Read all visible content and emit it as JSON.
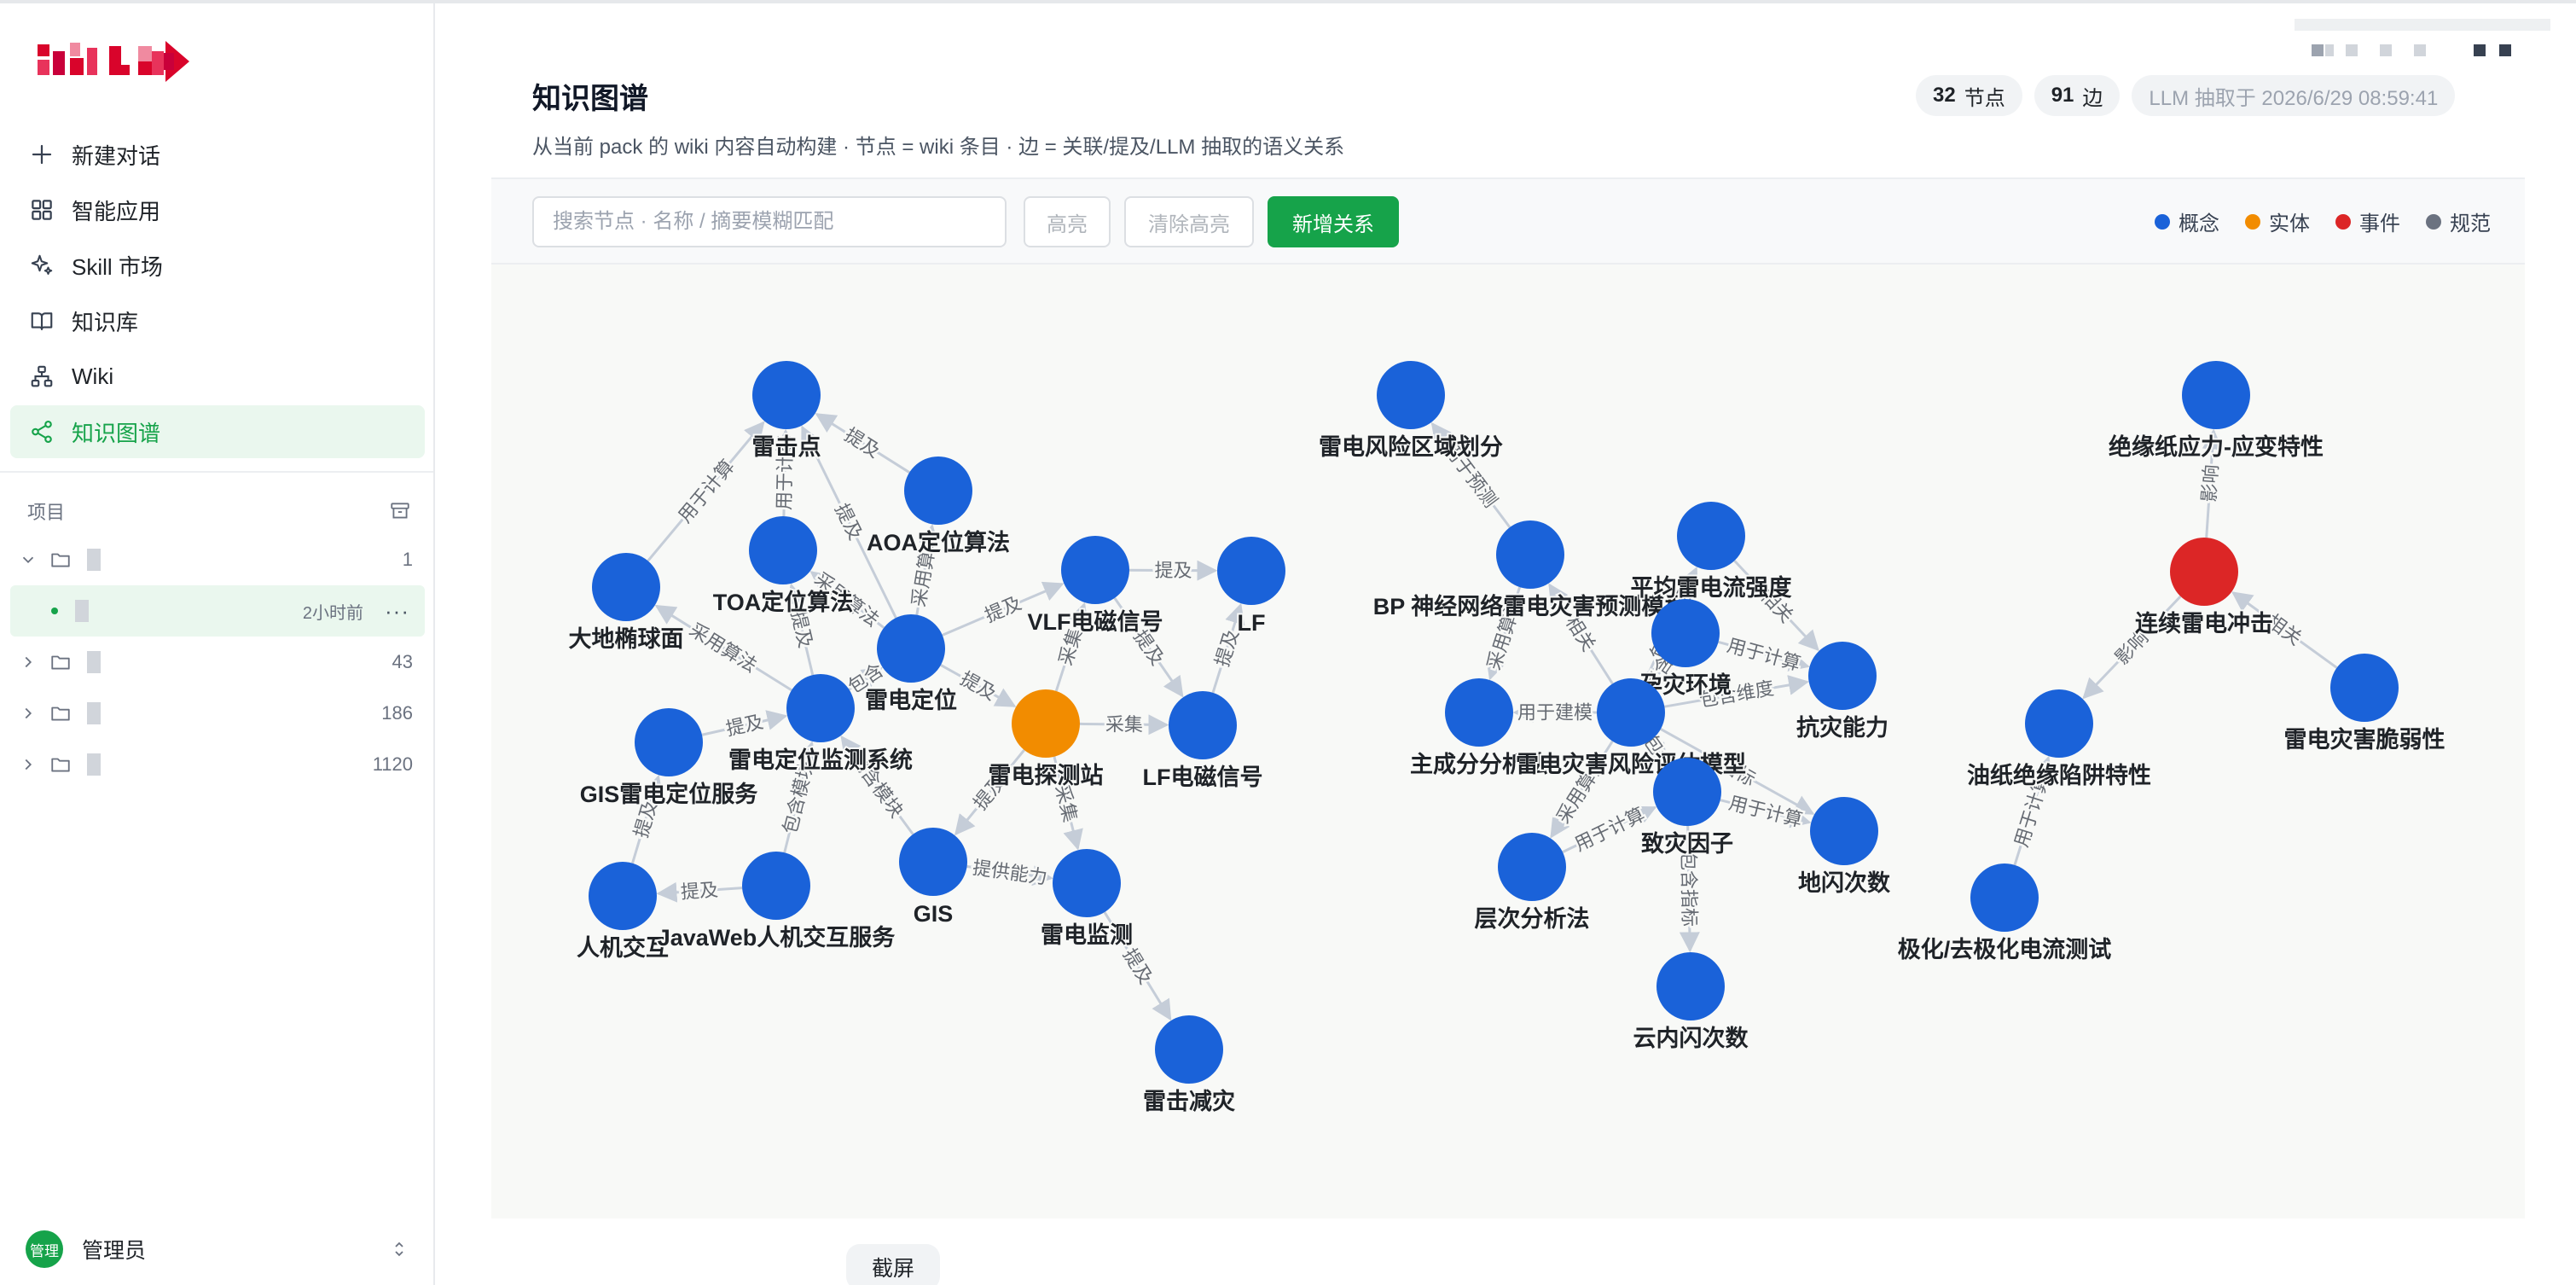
{
  "sidebar": {
    "nav": [
      {
        "label": "新建对话",
        "icon": "plus-icon"
      },
      {
        "label": "智能应用",
        "icon": "grid-icon"
      },
      {
        "label": "Skill 市场",
        "icon": "sparkle-icon"
      },
      {
        "label": "知识库",
        "icon": "book-icon"
      },
      {
        "label": "Wiki",
        "icon": "sitemap-icon"
      },
      {
        "label": "知识图谱",
        "icon": "share-nodes-icon"
      }
    ],
    "projects_header": "项目",
    "projects": [
      {
        "name": "",
        "count": "1"
      },
      {
        "name": "",
        "count": "43"
      },
      {
        "name": "",
        "count": "186"
      },
      {
        "name": "",
        "count": "1120"
      }
    ],
    "sub_item": {
      "name": "",
      "time": "2小时前",
      "more": "···"
    },
    "user": {
      "avatar_text": "管理",
      "name": "管理员"
    }
  },
  "header": {
    "title": "知识图谱",
    "subtitle": "从当前 pack 的 wiki 内容自动构建 · 节点 = wiki 条目 · 边 = 关联/提及/LLM 抽取的语义关系",
    "nodes_count": "32",
    "nodes_label": "节点",
    "edges_count": "91",
    "edges_label": "边",
    "llm_stamp": "LLM 抽取于 2026/6/29 08:59:41"
  },
  "toolbar": {
    "search_placeholder": "搜索节点 · 名称 / 摘要模糊匹配",
    "highlight_label": "高亮",
    "clear_label": "清除高亮",
    "add_relation_label": "新增关系"
  },
  "legend": [
    {
      "label": "概念",
      "color": "#1a62d9"
    },
    {
      "label": "实体",
      "color": "#f28c00"
    },
    {
      "label": "事件",
      "color": "#dc2626"
    },
    {
      "label": "规范",
      "color": "#6b7280"
    }
  ],
  "graph": {
    "colors": {
      "concept": "#1a62d9",
      "entity": "#f28c00",
      "event": "#dc2626",
      "edge": "#c5cdd8",
      "edge_label": "#666b73"
    },
    "nodes": [
      {
        "id": "leijidian",
        "label": "雷击点",
        "type": "concept"
      },
      {
        "id": "aoa",
        "label": "AOA定位算法",
        "type": "concept"
      },
      {
        "id": "toa",
        "label": "TOA定位算法",
        "type": "concept"
      },
      {
        "id": "dadi",
        "label": "大地椭球面",
        "type": "concept"
      },
      {
        "id": "vlf",
        "label": "VLF电磁信号",
        "type": "concept"
      },
      {
        "id": "lf",
        "label": "LF",
        "type": "concept"
      },
      {
        "id": "leidiandingwei",
        "label": "雷电定位",
        "type": "concept"
      },
      {
        "id": "tance",
        "label": "雷电探测站",
        "type": "entity"
      },
      {
        "id": "lfsignal",
        "label": "LF电磁信号",
        "type": "concept"
      },
      {
        "id": "jiance_sys",
        "label": "雷电定位监测系统",
        "type": "concept"
      },
      {
        "id": "gis_service",
        "label": "GIS雷电定位服务",
        "type": "concept"
      },
      {
        "id": "gis",
        "label": "GIS",
        "type": "concept"
      },
      {
        "id": "jiance",
        "label": "雷电监测",
        "type": "concept"
      },
      {
        "id": "renji",
        "label": "人机交互",
        "type": "concept"
      },
      {
        "id": "javaweb",
        "label": "JavaWeb人机交互服务",
        "type": "concept"
      },
      {
        "id": "jianzai",
        "label": "雷击减灾",
        "type": "concept"
      },
      {
        "id": "fengxianquyu",
        "label": "雷电风险区域划分",
        "type": "concept"
      },
      {
        "id": "bp",
        "label": "BP 神经网络雷电灾害预测模型",
        "type": "concept"
      },
      {
        "id": "pingjun",
        "label": "平均雷电流强度",
        "type": "concept"
      },
      {
        "id": "yunzai",
        "label": "孕灾环境",
        "type": "concept"
      },
      {
        "id": "kangzai",
        "label": "抗灾能力",
        "type": "concept"
      },
      {
        "id": "zhuchengfen",
        "label": "主成分分析法",
        "type": "concept"
      },
      {
        "id": "fengxian_model",
        "label": "雷电灾害风险评估模型",
        "type": "concept"
      },
      {
        "id": "zhizai",
        "label": "致灾因子",
        "type": "concept"
      },
      {
        "id": "dishan",
        "label": "地闪次数",
        "type": "concept"
      },
      {
        "id": "cengci",
        "label": "层次分析法",
        "type": "concept"
      },
      {
        "id": "yunnei",
        "label": "云内闪次数",
        "type": "concept"
      },
      {
        "id": "juyuan",
        "label": "绝缘纸应力-应变特性",
        "type": "concept"
      },
      {
        "id": "lianxu",
        "label": "连续雷电冲击",
        "type": "event"
      },
      {
        "id": "youzhi",
        "label": "油纸绝缘陷阱特性",
        "type": "concept"
      },
      {
        "id": "cuiruo",
        "label": "雷电灾害脆弱性",
        "type": "concept"
      },
      {
        "id": "jihua",
        "label": "极化/去极化电流测试",
        "type": "concept"
      }
    ],
    "edges": [
      {
        "from": "dadi",
        "to": "leijidian",
        "label": "用于计算"
      },
      {
        "from": "aoa",
        "to": "leijidian",
        "label": "提及"
      },
      {
        "from": "toa",
        "to": "leijidian",
        "label": "用于计算"
      },
      {
        "from": "leidiandingwei",
        "to": "leijidian",
        "label": "提及"
      },
      {
        "from": "leidiandingwei",
        "to": "aoa",
        "label": "采用算法"
      },
      {
        "from": "leidiandingwei",
        "to": "toa",
        "label": "采用算法"
      },
      {
        "from": "jiance_sys",
        "to": "dadi",
        "label": "采用算法"
      },
      {
        "from": "jiance_sys",
        "to": "toa",
        "label": "提及"
      },
      {
        "from": "jiance_sys",
        "to": "leidiandingwei",
        "label": "包含"
      },
      {
        "from": "leidiandingwei",
        "to": "vlf",
        "label": "提及"
      },
      {
        "from": "vlf",
        "to": "lf",
        "label": "提及"
      },
      {
        "from": "tance",
        "to": "vlf",
        "label": "采集"
      },
      {
        "from": "tance",
        "to": "lfsignal",
        "label": "采集"
      },
      {
        "from": "lfsignal",
        "to": "lf",
        "label": "提及"
      },
      {
        "from": "leidiandingwei",
        "to": "tance",
        "label": "提及"
      },
      {
        "from": "gis_service",
        "to": "jiance_sys",
        "label": "提及"
      },
      {
        "from": "renji",
        "to": "gis_service",
        "label": "提及"
      },
      {
        "from": "javaweb",
        "to": "renji",
        "label": "提及"
      },
      {
        "from": "gis",
        "to": "jiance_sys",
        "label": "包含模块"
      },
      {
        "from": "gis",
        "to": "jiance",
        "label": "提供能力"
      },
      {
        "from": "tance",
        "to": "jiance",
        "label": "采集"
      },
      {
        "from": "tance",
        "to": "gis",
        "label": "提及"
      },
      {
        "from": "jiance",
        "to": "jianzai",
        "label": "提及"
      },
      {
        "from": "javaweb",
        "to": "jiance_sys",
        "label": "包含模块"
      },
      {
        "from": "vlf",
        "to": "lfsignal",
        "label": "提及"
      },
      {
        "from": "bp",
        "to": "fengxianquyu",
        "label": "用于预测"
      },
      {
        "from": "fengxian_model",
        "to": "bp",
        "label": "相关"
      },
      {
        "from": "fengxian_model",
        "to": "pingjun",
        "label": "包含指标"
      },
      {
        "from": "fengxian_model",
        "to": "yunzai",
        "label": "包含"
      },
      {
        "from": "fengxian_model",
        "to": "kangzai",
        "label": "包含维度"
      },
      {
        "from": "fengxian_model",
        "to": "zhuchengfen",
        "label": "用于建模"
      },
      {
        "from": "fengxian_model",
        "to": "cengci",
        "label": "采用算法"
      },
      {
        "from": "fengxian_model",
        "to": "zhizai",
        "label": "包含"
      },
      {
        "from": "fengxian_model",
        "to": "dishan",
        "label": "指标"
      },
      {
        "from": "zhizai",
        "to": "yunnei",
        "label": "包含指标"
      },
      {
        "from": "zhizai",
        "to": "dishan",
        "label": "用于计算"
      },
      {
        "from": "pingjun",
        "to": "kangzai",
        "label": "相关"
      },
      {
        "from": "yunzai",
        "to": "kangzai",
        "label": "用于计算"
      },
      {
        "from": "bp",
        "to": "zhuchengfen",
        "label": "采用算法"
      },
      {
        "from": "cengci",
        "to": "zhizai",
        "label": "用于计算"
      },
      {
        "from": "lianxu",
        "to": "juyuan",
        "label": "影响"
      },
      {
        "from": "lianxu",
        "to": "youzhi",
        "label": "影响"
      },
      {
        "from": "cuiruo",
        "to": "lianxu",
        "label": "相关"
      },
      {
        "from": "jihua",
        "to": "youzhi",
        "label": "用于计算"
      }
    ]
  }
}
